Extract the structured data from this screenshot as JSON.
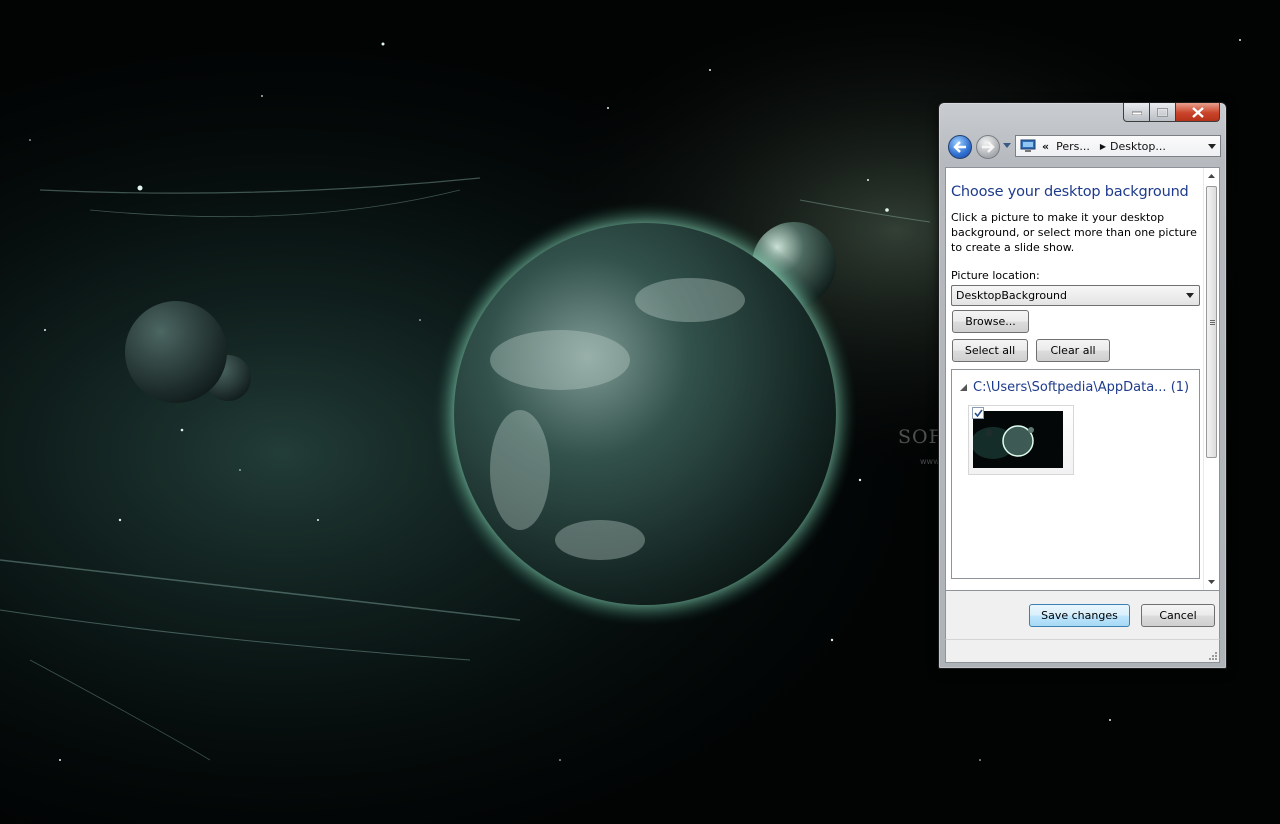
{
  "window": {
    "address": {
      "chevron": "«",
      "crumb1": "Pers...",
      "crumb2": "Desktop..."
    },
    "caption_buttons": [
      "minimize",
      "maximize",
      "close"
    ]
  },
  "content": {
    "title": "Choose your desktop background",
    "description": "Click a picture to make it your desktop background, or select more than one picture to create a slide show.",
    "picture_location_label": "Picture location:",
    "picture_location_value": "DesktopBackground",
    "browse_label": "Browse...",
    "select_all_label": "Select all",
    "clear_all_label": "Clear all",
    "gallery": {
      "group_label": "C:\\Users\\Softpedia\\AppData... (1)",
      "items": [
        {
          "checked": true
        }
      ]
    }
  },
  "footer": {
    "save_label": "Save changes",
    "cancel_label": "Cancel"
  },
  "watermark": {
    "text": "SOFTPEDIA",
    "url": "www.softpedia.com"
  },
  "colors": {
    "accent_title": "#1e3b8b",
    "close_button": "#c9442a"
  },
  "icons": [
    "back-arrow-icon",
    "forward-arrow-icon",
    "computer-icon",
    "dropdown-arrow-icon",
    "collapse-triangle-icon",
    "checkbox-check-icon"
  ]
}
